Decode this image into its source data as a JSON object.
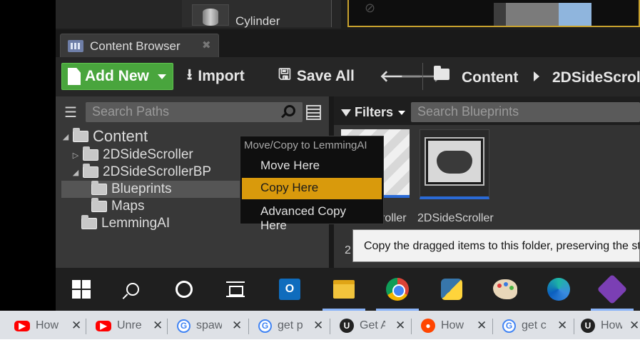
{
  "place_actors": {
    "item_label": "Cylinder"
  },
  "content_browser": {
    "tab_label": "Content Browser",
    "toolbar": {
      "add_new": "Add New",
      "import": "Import",
      "save_all": "Save All",
      "breadcrumb": [
        "Content",
        "2DSideScrol"
      ]
    },
    "paths": {
      "search_placeholder": "Search Paths",
      "tree": [
        {
          "label": "Content",
          "depth": 0,
          "expanded": true
        },
        {
          "label": "2DSideScroller",
          "depth": 1,
          "expanded": false
        },
        {
          "label": "2DSideScrollerBP",
          "depth": 1,
          "expanded": true
        },
        {
          "label": "Blueprints",
          "depth": 2,
          "selected": true
        },
        {
          "label": "Maps",
          "depth": 2
        },
        {
          "label": "LemmingAI",
          "depth": 1
        }
      ]
    },
    "assets": {
      "filters_label": "Filters",
      "search_placeholder": "Search Blueprints",
      "items": [
        {
          "label": "scroller"
        },
        {
          "label": "2DSideScroller"
        }
      ],
      "obscured_text": "2"
    }
  },
  "context_menu": {
    "title": "Move/Copy to LemmingAI",
    "items": [
      "Move Here",
      "Copy Here",
      "Advanced Copy Here"
    ],
    "highlighted_index": 1
  },
  "tooltip": "Copy the dragged items to this folder, preserving the str",
  "taskbar": {
    "apps": [
      "windows-start",
      "search",
      "cortana",
      "task-view",
      "outlook",
      "file-explorer",
      "chrome",
      "python",
      "paint",
      "edge",
      "gitkraken"
    ]
  },
  "browser_tabs": [
    {
      "icon": "youtube",
      "label": "How"
    },
    {
      "icon": "youtube",
      "label": "Unre"
    },
    {
      "icon": "google",
      "label": "spaw"
    },
    {
      "icon": "google",
      "label": "get p"
    },
    {
      "icon": "unreal",
      "label": "Get A"
    },
    {
      "icon": "reddit",
      "label": "How"
    },
    {
      "icon": "google",
      "label": "get c"
    },
    {
      "icon": "unreal",
      "label": "How"
    }
  ],
  "colors": {
    "add_new_green": "#49a53d",
    "menu_highlight": "#d99a0c",
    "selection_blue": "#2a6ad6"
  }
}
